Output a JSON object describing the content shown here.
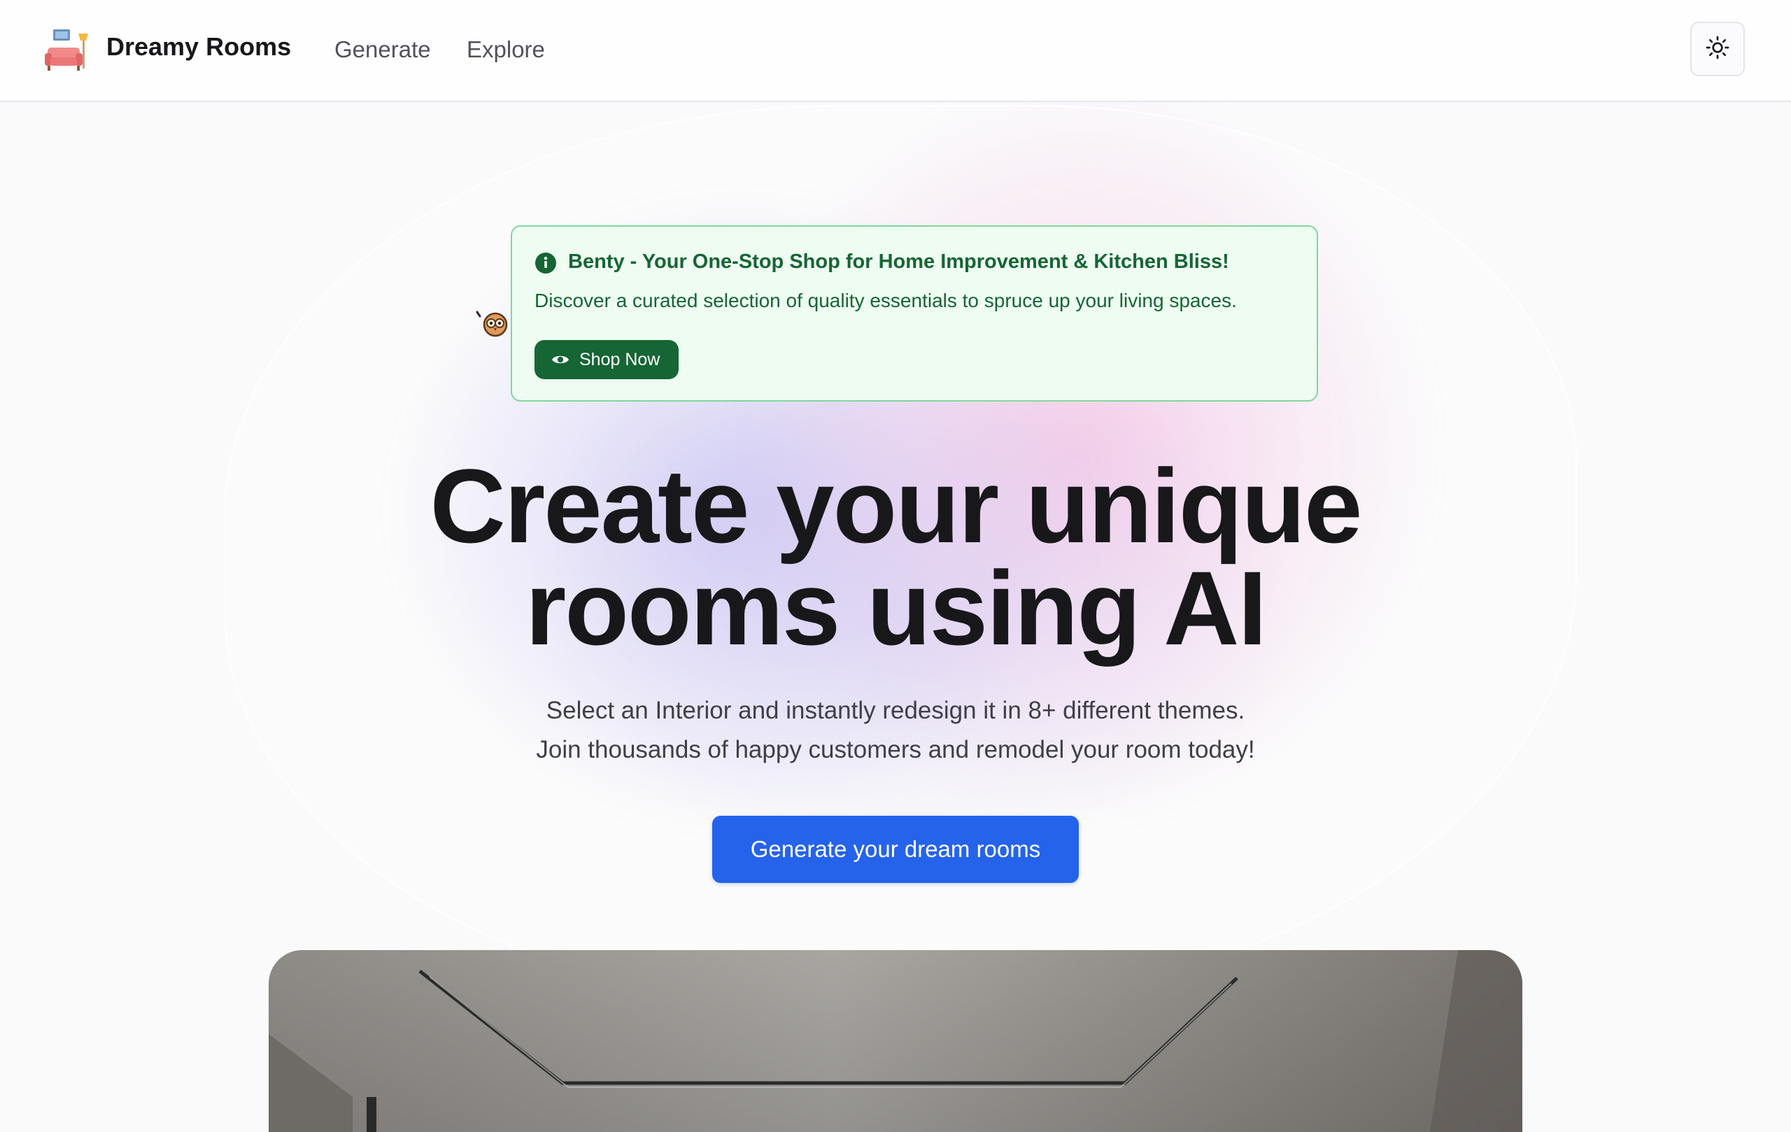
{
  "header": {
    "brand": "Dreamy Rooms",
    "logo_icon": "sofa-icon",
    "nav": [
      {
        "label": "Generate"
      },
      {
        "label": "Explore"
      }
    ],
    "theme_toggle_icon": "sun-icon"
  },
  "alert": {
    "icon": "info-icon",
    "title": "Benty - Your One-Stop Shop for Home Improvement & Kitchen Bliss!",
    "description": "Discover a curated selection of quality essentials to spruce up your living spaces.",
    "button": {
      "label": "Shop Now",
      "icon": "eye-icon"
    },
    "accent_color": "#166534",
    "background_color": "#eefcf2",
    "border_color": "#7fd89b"
  },
  "hero": {
    "title_lines": [
      "Create your unique",
      "rooms using AI"
    ],
    "subtitle_lines": [
      "Select an Interior and instantly redesign it in 8+ different themes.",
      "Join thousands of happy customers and remodel your room today!"
    ],
    "cta_label": "Generate your dream rooms",
    "cta_color": "#2563eb"
  },
  "preview": {
    "image": "room-interior-preview"
  }
}
